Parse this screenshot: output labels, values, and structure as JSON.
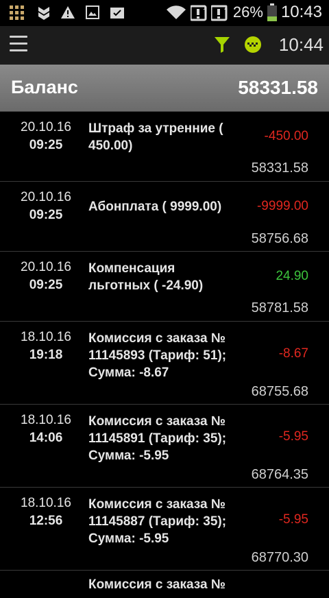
{
  "status_bar": {
    "battery_percent": "26%",
    "time": "10:43",
    "icons": [
      "grid-icon",
      "shield-icon",
      "warning-icon",
      "image-icon",
      "clipboard-icon",
      "wifi-icon",
      "notification-1-icon",
      "notification-2-icon",
      "battery-icon"
    ]
  },
  "app_bar": {
    "menu_icon": "hamburger-icon",
    "filter_icon": "filter-icon",
    "taxi_icon": "taxi-icon",
    "time": "10:44",
    "filter_color": "#a6d400",
    "taxi_color": "#b5d400"
  },
  "balance": {
    "label": "Баланс",
    "value": "58331.58"
  },
  "transactions": [
    {
      "date": "20.10.16",
      "time": "09:25",
      "description": "Штраф за утренние ( 450.00)",
      "amount": "-450.00",
      "sign": "neg",
      "running": "58331.58"
    },
    {
      "date": "20.10.16",
      "time": "09:25",
      "description": "Абонплата ( 9999.00)",
      "amount": "-9999.00",
      "sign": "neg",
      "running": "58756.68"
    },
    {
      "date": "20.10.16",
      "time": "09:25",
      "description": "Компенсация льготных ( -24.90)",
      "amount": "24.90",
      "sign": "pos",
      "running": "58781.58"
    },
    {
      "date": "18.10.16",
      "time": "19:18",
      "description": "Комиссия с заказа № 11145893 (Тариф: 51); Сумма: -8.67",
      "amount": "-8.67",
      "sign": "neg",
      "running": "68755.68"
    },
    {
      "date": "18.10.16",
      "time": "14:06",
      "description": "Комиссия с заказа № 11145891 (Тариф: 35); Сумма: -5.95",
      "amount": "-5.95",
      "sign": "neg",
      "running": "68764.35"
    },
    {
      "date": "18.10.16",
      "time": "12:56",
      "description": "Комиссия с заказа № 11145887 (Тариф: 35); Сумма: -5.95",
      "amount": "-5.95",
      "sign": "neg",
      "running": "68770.30"
    },
    {
      "date": "",
      "time": "",
      "description": "Комиссия с заказа №",
      "amount": "",
      "sign": "neg",
      "running": ""
    }
  ]
}
